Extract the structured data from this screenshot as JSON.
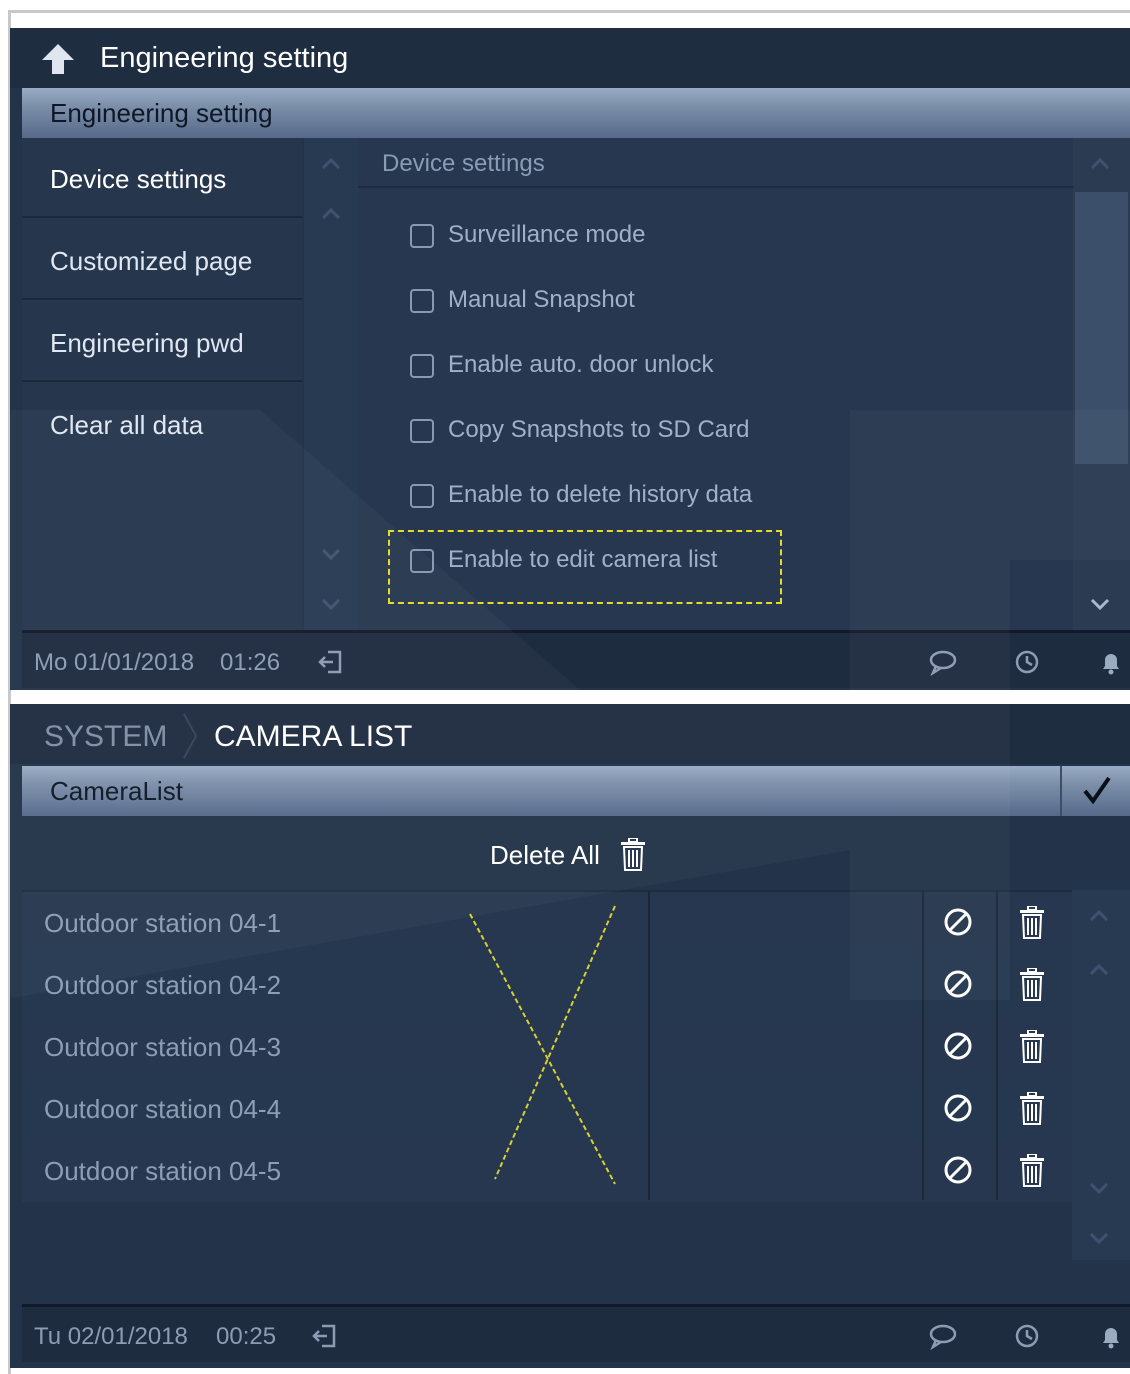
{
  "screen1": {
    "title": "Engineering setting",
    "section_title": "Engineering setting",
    "nav": [
      {
        "label": "Device settings"
      },
      {
        "label": "Customized page"
      },
      {
        "label": "Engineering pwd"
      },
      {
        "label": "Clear all data"
      }
    ],
    "content_title": "Device settings",
    "options": [
      {
        "label": "Surveillance mode",
        "checked": false
      },
      {
        "label": "Manual Snapshot",
        "checked": false
      },
      {
        "label": "Enable auto. door unlock",
        "checked": false
      },
      {
        "label": "Copy Snapshots to SD Card",
        "checked": false
      },
      {
        "label": "Enable to delete history data",
        "checked": false
      },
      {
        "label": "Enable to edit camera list",
        "checked": false
      }
    ],
    "status": {
      "date": "Mo 01/01/2018",
      "time": "01:26"
    }
  },
  "screen2": {
    "breadcrumb": {
      "parent": "SYSTEM",
      "current": "CAMERA LIST"
    },
    "section_title": "CameraList",
    "delete_all_label": "Delete All",
    "cameras": [
      {
        "name": "Outdoor station 04-1"
      },
      {
        "name": "Outdoor station 04-2"
      },
      {
        "name": "Outdoor station 04-3"
      },
      {
        "name": "Outdoor station 04-4"
      },
      {
        "name": "Outdoor station 04-5"
      }
    ],
    "status": {
      "date": "Tu 02/01/2018",
      "time": "00:25"
    }
  },
  "icons": {
    "back": "back-arrow-icon",
    "logout": "logout-icon",
    "message": "message-icon",
    "history": "history-icon",
    "alarm": "bell-icon",
    "confirm": "checkmark-icon",
    "disable": "disable-icon",
    "delete": "trash-icon"
  },
  "colors": {
    "background": "#233349",
    "section_bar": "#7d90aa",
    "highlight": "#e4dc2a",
    "text": "#ffffff"
  }
}
